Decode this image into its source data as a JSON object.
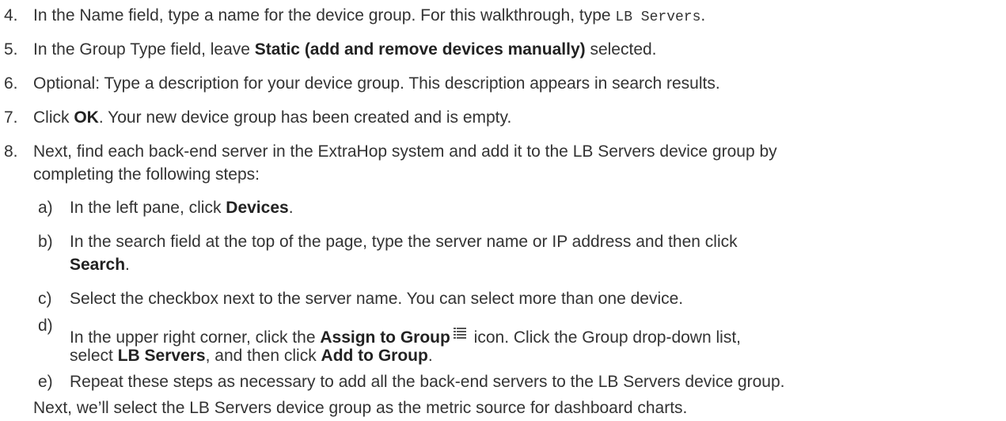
{
  "steps": [
    {
      "num": "4.",
      "t1": "In the Name field, type a name for the device group. For this walkthrough, type ",
      "code": "LB Servers",
      "t2": "."
    },
    {
      "num": "5.",
      "t1": "In the Group Type field, leave ",
      "b1": "Static (add and remove devices manually)",
      "t2": " selected."
    },
    {
      "num": "6.",
      "t1": "Optional: Type a description for your device group. This description appears in search results."
    },
    {
      "num": "7.",
      "t1": "Click ",
      "b1": "OK",
      "t2": ". Your new device group has been created and is empty."
    },
    {
      "num": "8.",
      "line1": "Next, find each back-end server in the ExtraHop system and add it to the LB Servers device group by",
      "line2": "completing the following steps:"
    }
  ],
  "substeps": [
    {
      "num": "a)",
      "t1": "In the left pane, click ",
      "b1": "Devices",
      "t2": "."
    },
    {
      "num": "b)",
      "line1": "In the search field at the top of the page, type the server name or IP address and then click",
      "b1": "Search",
      "t2": "."
    },
    {
      "num": "c)",
      "t1": "Select the checkbox next to the server name. You can select more than one device."
    },
    {
      "num": "d)",
      "t1": "In the upper right corner, click the ",
      "b1": "Assign to Group",
      "t2": " icon. Click the Group drop-down list,",
      "t3": "select ",
      "b2": "LB Servers",
      "t4": ", and then click ",
      "b3": "Add to Group",
      "t5": ".",
      "icon": "list-icon"
    },
    {
      "num": "e)",
      "t1": "Repeat these steps as necessary to add all the back-end servers to the LB Servers device group."
    }
  ],
  "closing": "Next, we’ll select the LB Servers device group as the metric source for dashboard charts."
}
